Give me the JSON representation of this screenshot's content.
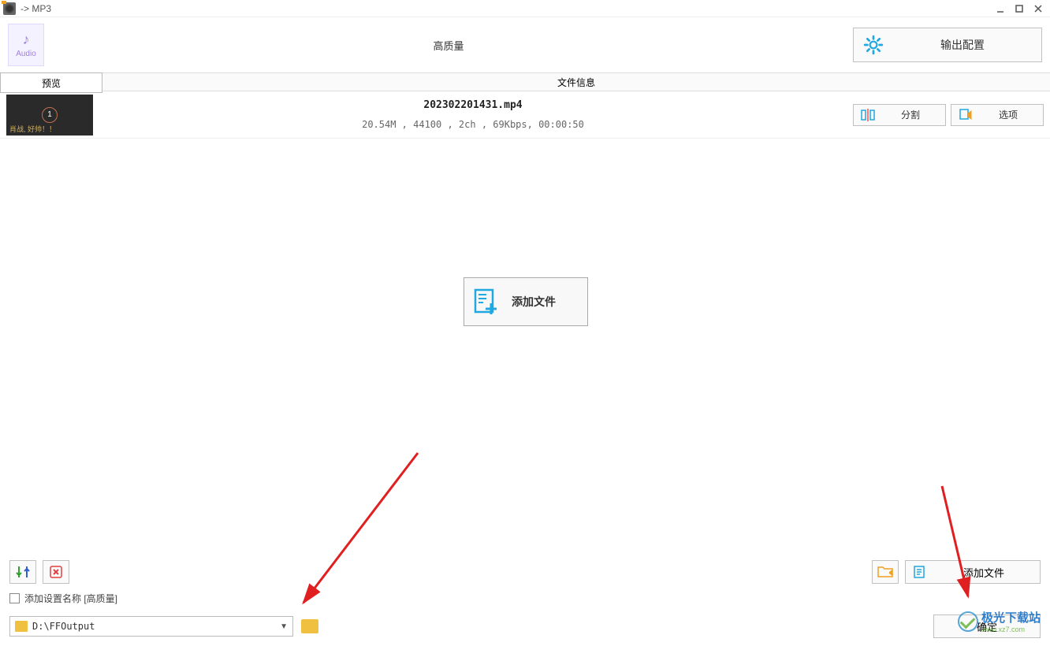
{
  "title": "-> MP3",
  "toolbar": {
    "audio_label": "Audio",
    "quality_label": "高质量",
    "output_config": "输出配置"
  },
  "columns": {
    "preview": "预览",
    "file_info": "文件信息"
  },
  "file": {
    "name": "202302201431.mp4",
    "meta": "20.54M , 44100 , 2ch , 69Kbps, 00:00:50",
    "thumb_badge": "1",
    "thumb_caption": "肖战, 好帅！！",
    "split_btn": "分割",
    "options_btn": "选项"
  },
  "center": {
    "add_file": "添加文件"
  },
  "bottom": {
    "checkbox_label": "添加设置名称 [高质量]",
    "output_path": "D:\\FFOutput",
    "add_file_btn": "添加文件",
    "confirm": "确定"
  },
  "watermark": {
    "line1": "极光下载站",
    "line2": "www.xz7.com"
  }
}
